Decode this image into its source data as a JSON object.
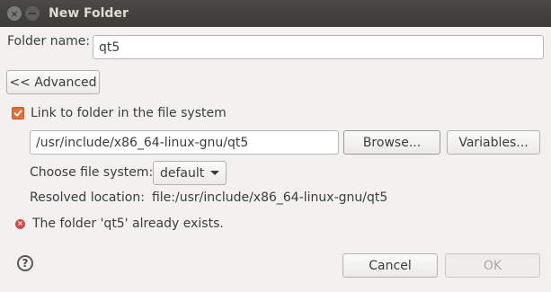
{
  "window": {
    "title": "New Folder",
    "close_glyph": "×"
  },
  "folder_name": {
    "label": "Folder name:",
    "value": "qt5"
  },
  "advanced_button": "<< Advanced",
  "link_checkbox": {
    "label": "Link to folder in the file system",
    "checked": true,
    "accent": "#e0703e"
  },
  "link_path": {
    "value": "/usr/include/x86_64-linux-gnu/qt5"
  },
  "browse_button": "Browse...",
  "variables_button": "Variables...",
  "file_system": {
    "label": "Choose file system:",
    "selected": "default"
  },
  "resolved": {
    "label": "Resolved location:",
    "value": "file:/usr/include/x86_64-linux-gnu/qt5"
  },
  "error": {
    "icon": "error-icon",
    "glyph": "×",
    "message": "The folder 'qt5' already exists.",
    "color": "#d44a4a"
  },
  "help": {
    "icon": "help-icon",
    "glyph": "?"
  },
  "buttons": {
    "cancel": "Cancel",
    "ok": "OK"
  }
}
